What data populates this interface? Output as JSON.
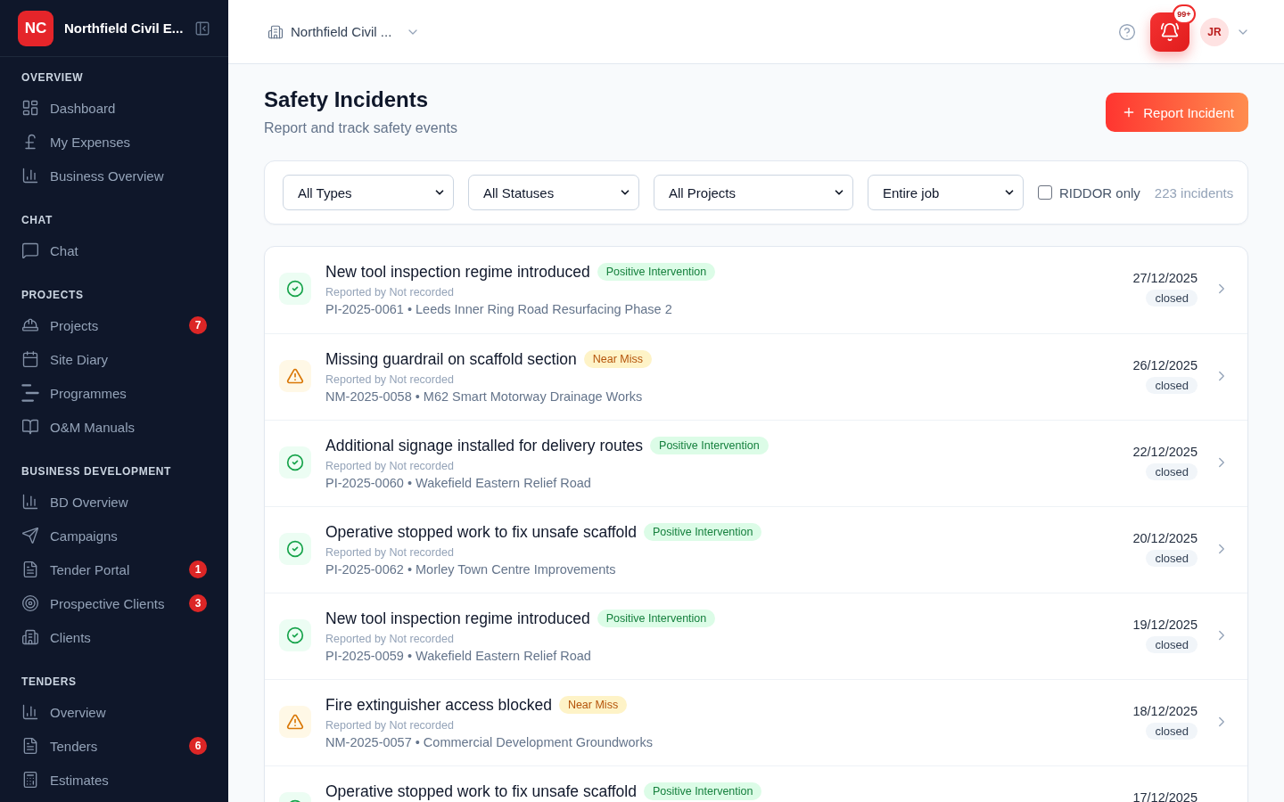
{
  "sidebar": {
    "logo": "NC",
    "company": "Northfield Civil E...",
    "sections": [
      {
        "title": "OVERVIEW",
        "items": [
          {
            "kind": "dashboard",
            "label": "Dashboard",
            "selected": false
          },
          {
            "kind": "expenses",
            "label": "My Expenses",
            "selected": false
          },
          {
            "kind": "analytics",
            "label": "Business Overview",
            "selected": false
          }
        ]
      },
      {
        "title": "CHAT",
        "items": [
          {
            "kind": "chat",
            "label": "Chat",
            "selected": false
          }
        ]
      },
      {
        "title": "PROJECTS",
        "items": [
          {
            "kind": "projects",
            "label": "Projects",
            "selected": false,
            "badge": "7"
          },
          {
            "kind": "diary",
            "label": "Site Diary",
            "selected": false
          },
          {
            "kind": "programmes",
            "label": "Programmes",
            "selected": false
          },
          {
            "kind": "manuals",
            "label": "O&M Manuals",
            "selected": false
          }
        ]
      },
      {
        "title": "BUSINESS DEVELOPMENT",
        "items": [
          {
            "kind": "analytics",
            "label": "BD Overview",
            "selected": false
          },
          {
            "kind": "campaigns",
            "label": "Campaigns",
            "selected": false
          },
          {
            "kind": "documents",
            "label": "Tender Portal",
            "selected": false,
            "badge": "1"
          },
          {
            "kind": "prospects",
            "label": "Prospective Clients",
            "selected": false,
            "badge": "3"
          },
          {
            "kind": "clients",
            "label": "Clients",
            "selected": false
          }
        ]
      },
      {
        "title": "TENDERS",
        "items": [
          {
            "kind": "analytics",
            "label": "Overview",
            "selected": false
          },
          {
            "kind": "documents",
            "label": "Tenders",
            "selected": false,
            "badge": "6"
          },
          {
            "kind": "estimates",
            "label": "Estimates",
            "selected": false
          }
        ]
      }
    ]
  },
  "topbar": {
    "company": "Northfield Civil ...",
    "notifications": "99+",
    "avatar": "JR"
  },
  "page": {
    "title": "Safety Incidents",
    "subtitle": "Report and track safety events",
    "action": "Report Incident"
  },
  "filters": {
    "selects": [
      {
        "value": "All Types"
      },
      {
        "value": "All Statuses"
      },
      {
        "value": "All Projects"
      },
      {
        "value": "Entire job"
      }
    ],
    "riddor": {
      "label": "RIDDOR only",
      "checked": false
    },
    "count": "223 incidents"
  },
  "incidents": [
    {
      "kind": "positive",
      "title": "New tool inspection regime introduced",
      "tag": "Positive Intervention",
      "reported": "Reported by Not recorded",
      "reference": "PI-2025-0061 • Leeds Inner Ring Road Resurfacing Phase 2",
      "date": "27/12/2025",
      "status": "closed"
    },
    {
      "kind": "near_miss",
      "title": "Missing guardrail on scaffold section",
      "tag": "Near Miss",
      "reported": "Reported by Not recorded",
      "reference": "NM-2025-0058 • M62 Smart Motorway Drainage Works",
      "date": "26/12/2025",
      "status": "closed"
    },
    {
      "kind": "positive",
      "title": "Additional signage installed for delivery routes",
      "tag": "Positive Intervention",
      "reported": "Reported by Not recorded",
      "reference": "PI-2025-0060 • Wakefield Eastern Relief Road",
      "date": "22/12/2025",
      "status": "closed"
    },
    {
      "kind": "positive",
      "title": "Operative stopped work to fix unsafe scaffold",
      "tag": "Positive Intervention",
      "reported": "Reported by Not recorded",
      "reference": "PI-2025-0062 • Morley Town Centre Improvements",
      "date": "20/12/2025",
      "status": "closed"
    },
    {
      "kind": "positive",
      "title": "New tool inspection regime introduced",
      "tag": "Positive Intervention",
      "reported": "Reported by Not recorded",
      "reference": "PI-2025-0059 • Wakefield Eastern Relief Road",
      "date": "19/12/2025",
      "status": "closed"
    },
    {
      "kind": "near_miss",
      "title": "Fire extinguisher access blocked",
      "tag": "Near Miss",
      "reported": "Reported by Not recorded",
      "reference": "NM-2025-0057 • Commercial Development Groundworks",
      "date": "18/12/2025",
      "status": "closed"
    },
    {
      "kind": "positive",
      "title": "Operative stopped work to fix unsafe scaffold",
      "tag": "Positive Intervention",
      "date": "17/12/2025"
    }
  ]
}
